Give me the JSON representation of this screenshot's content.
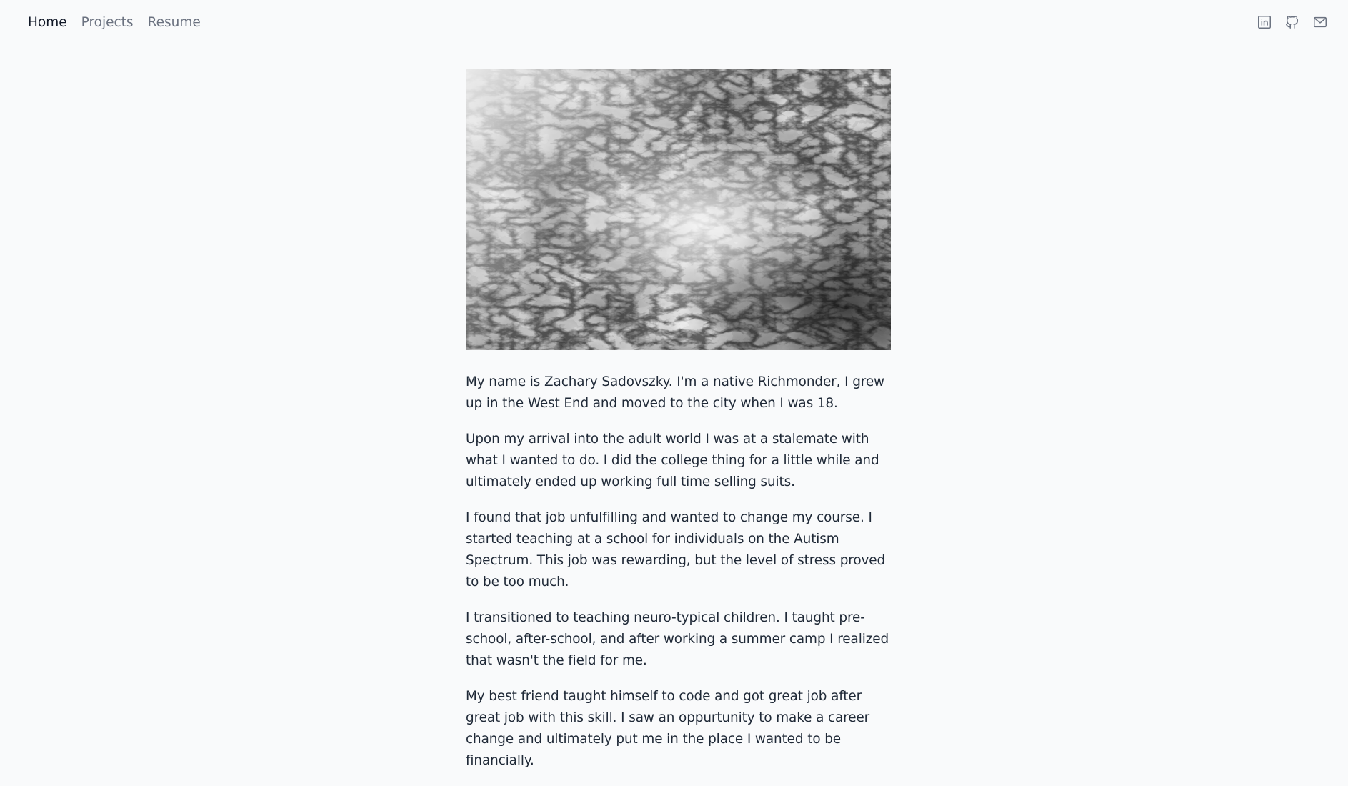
{
  "nav": {
    "links": [
      {
        "label": "Home",
        "active": true
      },
      {
        "label": "Projects",
        "active": false
      },
      {
        "label": "Resume",
        "active": false
      }
    ],
    "social": [
      {
        "icon": "linkedin-icon"
      },
      {
        "icon": "github-icon"
      },
      {
        "icon": "mail-icon"
      }
    ]
  },
  "hero": {
    "description_icon": "abstract-marbled-image"
  },
  "bio": {
    "paragraphs": [
      "My name is Zachary Sadovszky. I'm a native Richmonder, I grew up in the West End and moved to the city when I was 18.",
      "Upon my arrival into the adult world I was at a stalemate with what I wanted to do. I did the college thing for a little while and ultimately ended up working full time selling suits.",
      "I found that job unfulfilling and wanted to change my course. I started teaching at a school for individuals on the Autism Spectrum. This job was rewarding, but the level of stress proved to be too much.",
      "I transitioned to teaching neuro-typical children. I taught pre-school, after-school, and after working a summer camp I realized that wasn't the field for me.",
      "My best friend taught himself to code and got great job after great job with this skill. I saw an oppurtunity to make a career change and ultimately put me in the place I wanted to be financially."
    ]
  },
  "colors": {
    "background": "#f9fafb",
    "text": "#1f2937",
    "nav_inactive": "#6b7280",
    "icon": "#6b7280"
  }
}
